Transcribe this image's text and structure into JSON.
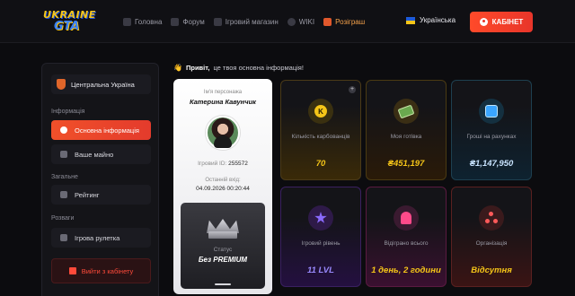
{
  "header": {
    "logo": {
      "line1": "UKRAINE",
      "line2": "GTA"
    },
    "nav": [
      {
        "label": "Головна",
        "icon": "home-icon"
      },
      {
        "label": "Форум",
        "icon": "forum-icon"
      },
      {
        "label": "Ігровий магазин",
        "icon": "shop-icon"
      },
      {
        "label": "WIKI",
        "icon": "globe-icon"
      },
      {
        "label": "Розіграш",
        "icon": "gift-icon"
      }
    ],
    "language": "Українська",
    "cabinet_button": "КАБІНЕТ"
  },
  "sidebar": {
    "region": "Центральна Україна",
    "section_info": "Інформація",
    "item_basic": "Основна інформація",
    "item_property": "Ваше майно",
    "section_general": "Загальне",
    "item_rating": "Рейтинг",
    "section_fun": "Розваги",
    "item_roulette": "Ігрова рулетка",
    "logout": "Вийти з кабінету"
  },
  "greeting": {
    "hello": "Привіт,",
    "text": "це твоя основна інформація!"
  },
  "profile": {
    "name_label": "Ім'я персонажа",
    "name": "Катерина Кавунчик",
    "id_label": "Ігровий ID:",
    "id": "255572",
    "last_login_label": "Останній вхід:",
    "last_login": "04.09.2026 00:20:44",
    "status_label": "Статус",
    "status": "Без PREMIUM"
  },
  "stats": [
    {
      "label": "Кількість карбованців",
      "value": "70",
      "icon": "coin-icon"
    },
    {
      "label": "Моя готівка",
      "value": "₴451,197",
      "icon": "cash-icon"
    },
    {
      "label": "Гроші на рахунках",
      "value": "₴1,147,950",
      "icon": "bank-icon"
    },
    {
      "label": "Ігровий рівень",
      "value": "11 LVL",
      "icon": "star-icon"
    },
    {
      "label": "Відіграно всього",
      "value": "1 день, 2 години",
      "icon": "timer-icon"
    },
    {
      "label": "Організація",
      "value": "Відсутня",
      "icon": "organization-icon"
    }
  ],
  "colors": {
    "accent": "#e8352a",
    "gold": "#f5c518",
    "background": "#0c0c0f"
  }
}
